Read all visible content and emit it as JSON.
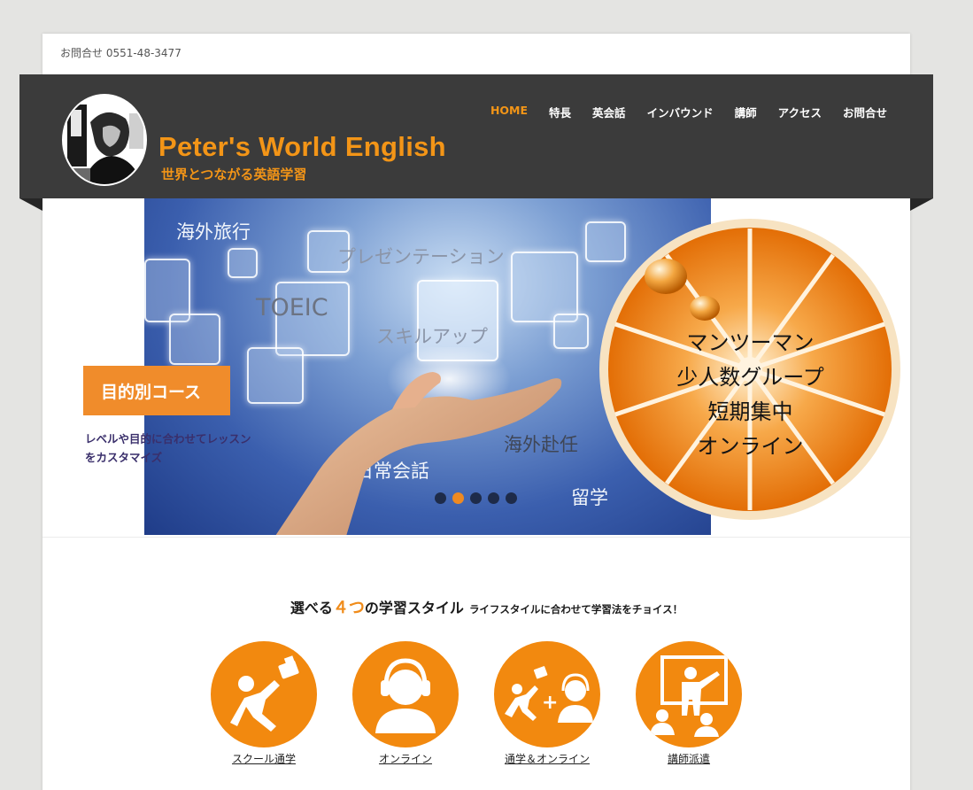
{
  "topbar": {
    "contact": "お問合せ 0551-48-3477"
  },
  "header": {
    "title": "Peter's World English",
    "subtitle": "世界とつながる英語学習"
  },
  "nav": {
    "items": [
      "HOME",
      "特長",
      "英会話",
      "インバウンド",
      "講師",
      "アクセス",
      "お問合せ"
    ],
    "active": "HOME"
  },
  "slider": {
    "words": {
      "travel": "海外旅行",
      "presentation": "プレゼンテーション",
      "toeic": "TOEIC",
      "skillup": "スキルアップ",
      "assignment": "海外赴任",
      "daily": "日常会話",
      "study_abroad": "留学"
    },
    "course_button": "目的別コース",
    "course_desc_line1": "レベルや目的に合わせてレッスン",
    "course_desc_line2": "をカスタマイズ",
    "orange_lines": [
      "マンツーマン",
      "少人数グループ",
      "短期集中",
      "オンライン"
    ],
    "slide_count": 5,
    "active_slide": 2
  },
  "section": {
    "title_pre": "選べる",
    "title_num": "４つ",
    "title_post": "の学習スタイル",
    "subtitle": "ライフスタイルに合わせて学習法をチョイス！"
  },
  "styles": [
    {
      "label": "スクール通学",
      "icon": "school-runner-icon"
    },
    {
      "label": "オンライン",
      "icon": "headset-person-icon"
    },
    {
      "label": "通学＆オンライン",
      "icon": "runner-plus-headset-icon"
    },
    {
      "label": "講師派遣",
      "icon": "teacher-board-icon"
    }
  ],
  "colors": {
    "accent": "#f39517",
    "header_bg": "#3b3b3b",
    "icon_orange": "#f2890f",
    "course_box": "#f08c2b"
  }
}
